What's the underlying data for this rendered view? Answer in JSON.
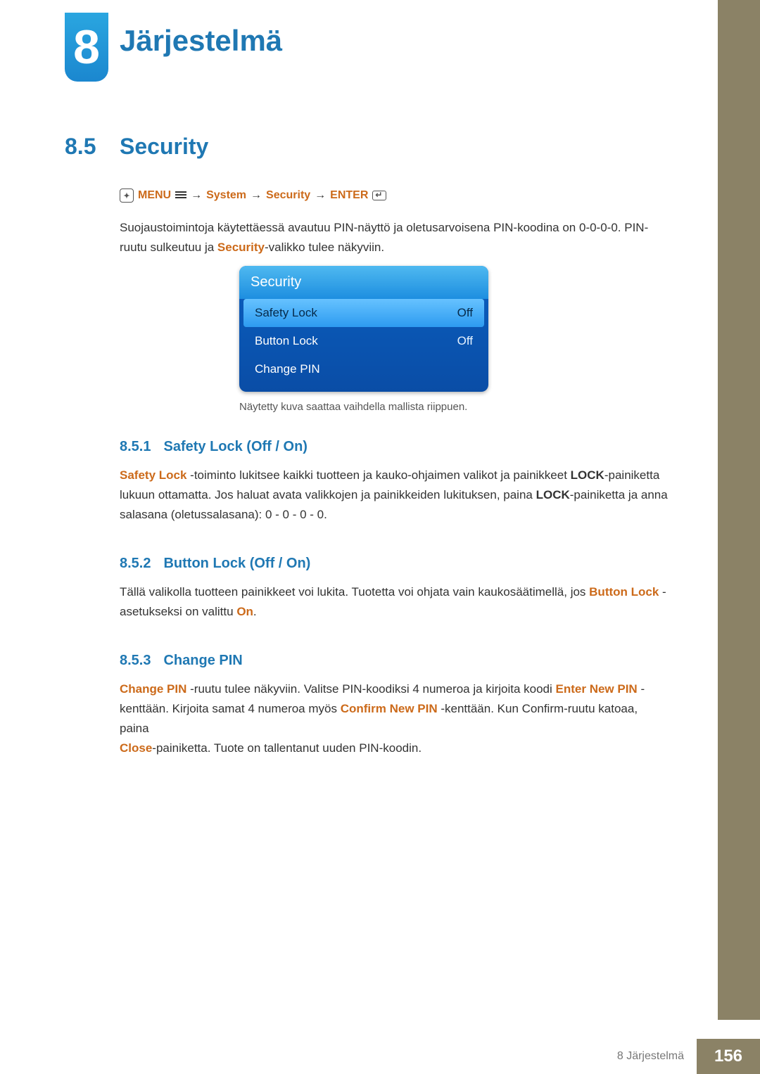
{
  "chapter": {
    "number": "8",
    "title": "Järjestelmä"
  },
  "section": {
    "number": "8.5",
    "title": "Security"
  },
  "breadcrumb": {
    "menu_label": "MENU",
    "sys_label": "System",
    "sec_label": "Security",
    "enter_label": "ENTER",
    "arrow": "→"
  },
  "intro": {
    "line1_pre": "Suojaustoimintoja käytettäessä avautuu PIN-näyttö ja oletusarvoisena PIN-koodina on 0-0-0-0. PIN-",
    "line2_pre": "ruutu sulkeutuu ja ",
    "line2_accent": "Security",
    "line2_post": "-valikko tulee näkyviin."
  },
  "osm": {
    "title": "Security",
    "rows": [
      {
        "label": "Safety Lock",
        "value": "Off",
        "selected": true
      },
      {
        "label": "Button Lock",
        "value": "Off",
        "selected": false
      },
      {
        "label": "Change PIN",
        "value": "",
        "selected": false
      }
    ],
    "caption": "Näytetty kuva saattaa vaihdella mallista riippuen."
  },
  "sub1": {
    "number": "8.5.1",
    "title": "Safety Lock (Off / On)",
    "t1": "Safety Lock",
    "t2": " -toiminto lukitsee kaikki tuotteen ja kauko-ohjaimen valikot ja painikkeet ",
    "t3": "LOCK",
    "t4": "-painiketta",
    "t5": "lukuun ottamatta. Jos haluat avata valikkojen ja painikkeiden lukituksen, paina ",
    "t6": "LOCK",
    "t7": "-painiketta ja anna",
    "t8": "salasana (oletussalasana): 0 - 0 - 0 - 0."
  },
  "sub2": {
    "number": "8.5.2",
    "title": "Button Lock (Off / On)",
    "t1": "Tällä valikolla tuotteen painikkeet voi lukita. Tuotetta voi ohjata vain kaukosäätimellä, jos ",
    "t2": "Button Lock",
    "t3": " -",
    "t4": "asetukseksi on valittu ",
    "t5": "On",
    "t6": "."
  },
  "sub3": {
    "number": "8.5.3",
    "title": "Change PIN",
    "t1": "Change PIN",
    "t2": " -ruutu tulee näkyviin. Valitse PIN-koodiksi 4 numeroa ja kirjoita koodi ",
    "t3": "Enter New PIN",
    "t4": " -",
    "t5": "kenttään. Kirjoita samat 4 numeroa myös ",
    "t6": "Confirm New PIN",
    "t7": " -kenttään. Kun Confirm-ruutu katoaa, paina",
    "t8": "Close",
    "t9": "-painiketta. Tuote on tallentanut uuden PIN-koodin."
  },
  "footer": {
    "label": "8 Järjestelmä",
    "page": "156"
  }
}
